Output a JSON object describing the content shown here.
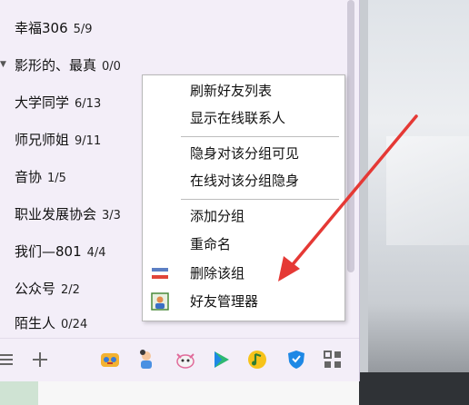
{
  "groups": [
    {
      "name": "幸福306",
      "count": "5/9"
    },
    {
      "name": "影形的、最真",
      "count": "0/0"
    },
    {
      "name": "大学同学",
      "count": "6/13"
    },
    {
      "name": "师兄师姐",
      "count": "9/11"
    },
    {
      "name": "音协",
      "count": "1/5"
    },
    {
      "name": "职业发展协会",
      "count": "3/3"
    },
    {
      "name": "我们—801",
      "count": "4/4"
    },
    {
      "name": "公众号",
      "count": "2/2"
    },
    {
      "name": "陌生人",
      "count": "0/24"
    }
  ],
  "context_menu": {
    "items": [
      {
        "label": "刷新好友列表"
      },
      {
        "label": "显示在线联系人"
      },
      {
        "label": "隐身对该分组可见"
      },
      {
        "label": "在线对该分组隐身"
      },
      {
        "label": "添加分组"
      },
      {
        "label": "重命名"
      },
      {
        "label": "删除该组",
        "icon": "delete-group-icon"
      },
      {
        "label": "好友管理器",
        "icon": "friend-manager-icon"
      }
    ]
  },
  "bottom_toolbar": {
    "icons": [
      "menu-icon",
      "add-icon",
      "game-icon",
      "kids-icon",
      "pet-icon",
      "video-play-icon",
      "music-icon",
      "shield-icon",
      "apps-grid-icon"
    ]
  },
  "colors": {
    "panel_bg": "#f3eef8",
    "annotation_arrow": "#e53935"
  }
}
